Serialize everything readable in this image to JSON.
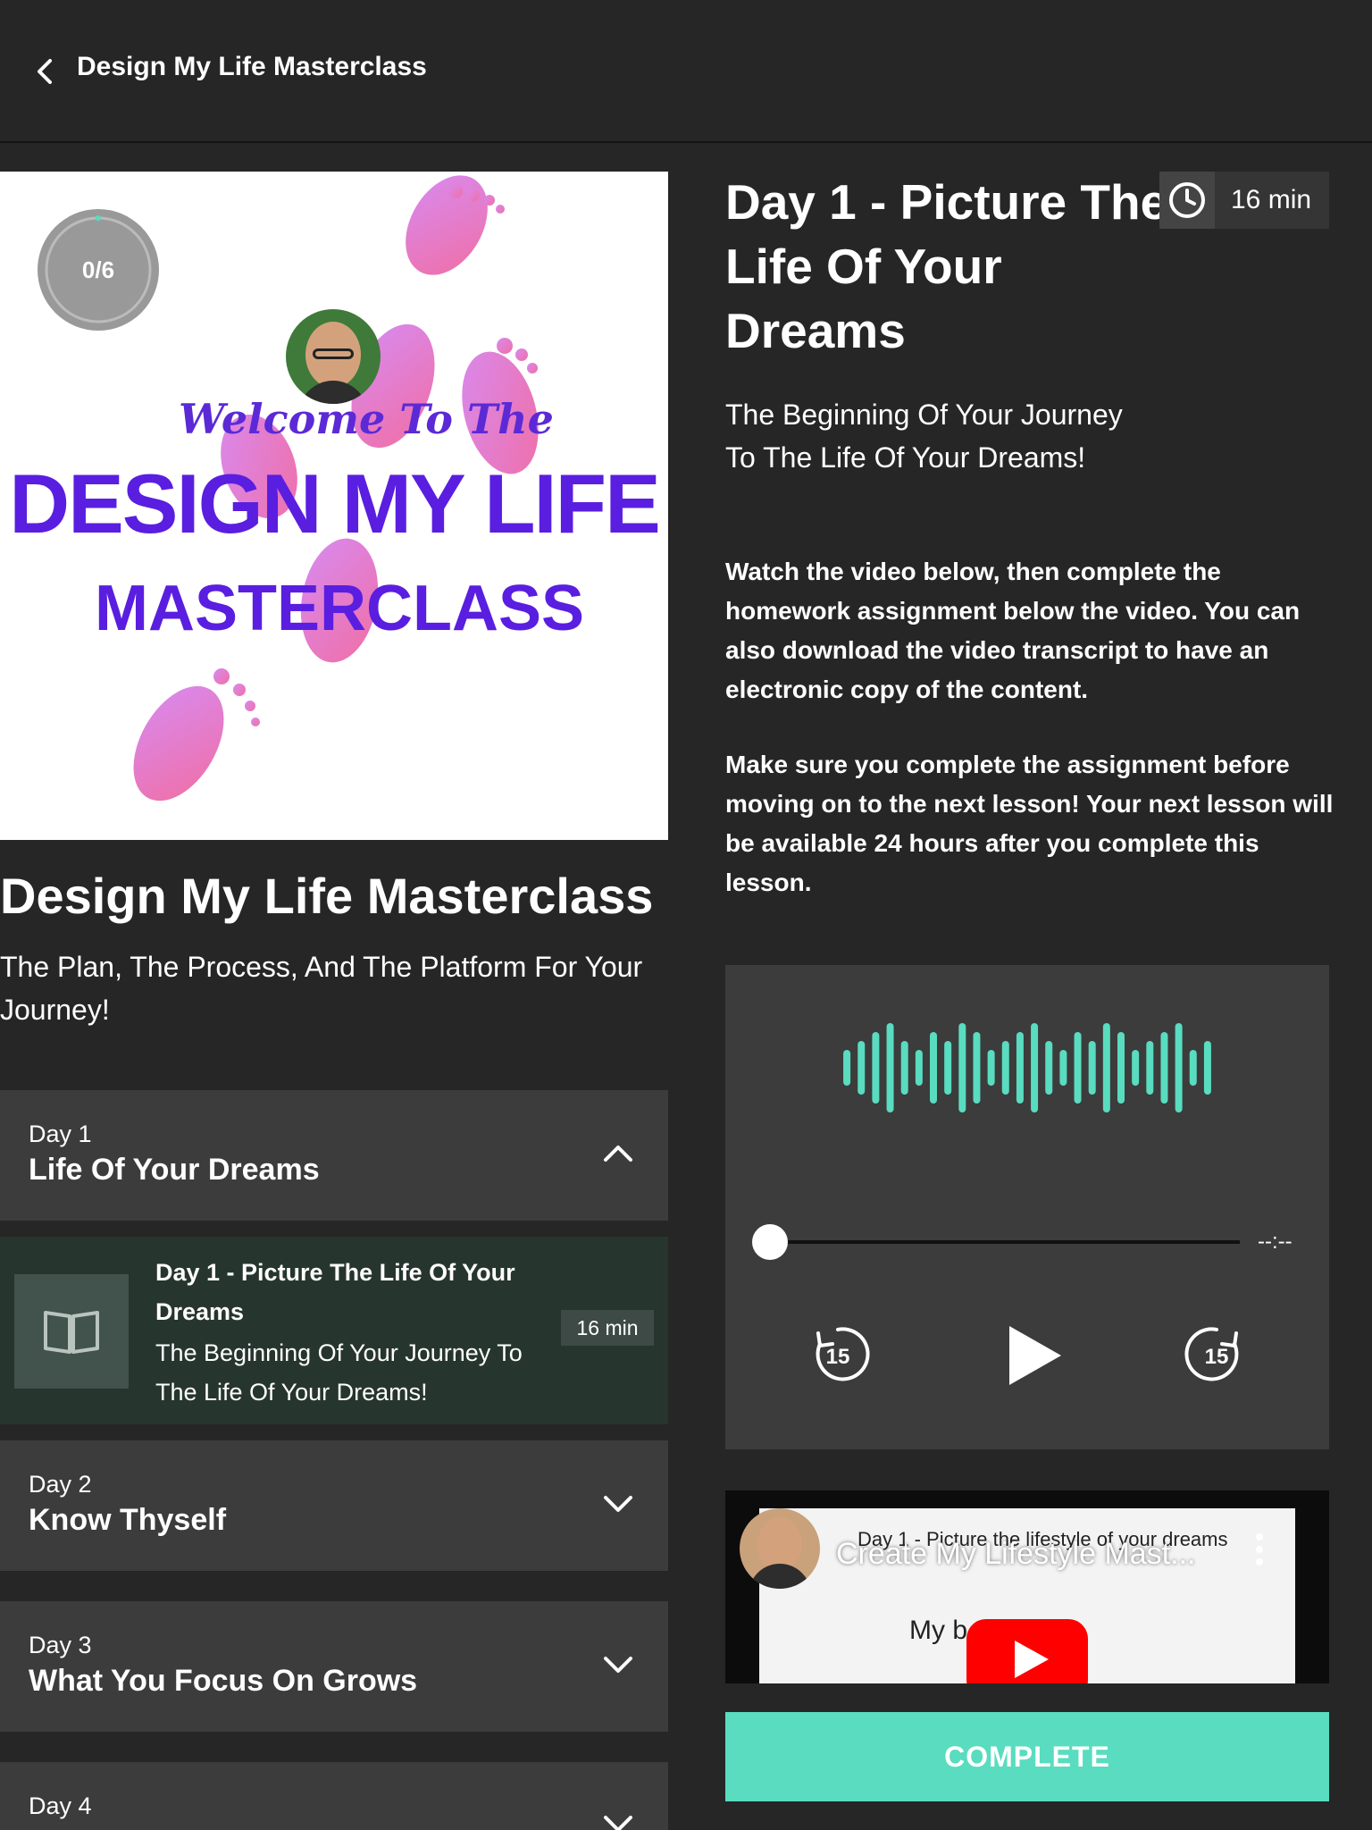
{
  "header": {
    "title": "Design My Life Masterclass",
    "back_icon": "chevron-left-icon"
  },
  "course": {
    "cover_title_line1": "Welcome To The",
    "cover_title_line2": "DESIGN MY LIFE",
    "cover_title_line3": "MASTERCLASS",
    "progress_text": "0/6",
    "progress_fraction": 0,
    "title": "Design My Life Masterclass",
    "subtitle": "The Plan, The Process, And The Platform For Your Journey!"
  },
  "sections": [
    {
      "day": "Day 1",
      "title": "Life Of Your Dreams",
      "expanded": true
    },
    {
      "day": "Day 2",
      "title": "Know Thyself",
      "expanded": false
    },
    {
      "day": "Day 3",
      "title": "What You Focus On Grows",
      "expanded": false
    },
    {
      "day": "Day 4",
      "title": "",
      "expanded": false
    }
  ],
  "current_lesson_item": {
    "title": "Day 1 - Picture The Life Of Your Dreams",
    "subtitle": "The Beginning Of Your Journey To The Life Of Your Dreams!",
    "duration": "16 min",
    "icon": "book-icon"
  },
  "lesson": {
    "title": "Day 1 - Picture The Life Of Your Dreams",
    "duration": "16 min",
    "subtitle_line1": "The Beginning Of Your Journey",
    "subtitle_line2": "To The Life Of Your Dreams!",
    "instructions_p1": "Watch the video below, then complete the homework assignment below the video. You can also download the video transcript to have an electronic copy of the content.",
    "instructions_p2": "Make sure you complete the assignment before moving on to the next lesson! Your next lesson will be available 24 hours after you complete this lesson."
  },
  "audio": {
    "time": "--:--",
    "rewind_label": "15",
    "forward_label": "15",
    "accent_color": "#59dcbf",
    "position_fraction": 0
  },
  "video": {
    "overlay_title": "Create My Lifestyle Mast...",
    "inner_title": "Day 1 - Picture the lifestyle of your dreams",
    "inner_text": "My b          .."
  },
  "actions": {
    "complete_label": "COMPLETE"
  }
}
